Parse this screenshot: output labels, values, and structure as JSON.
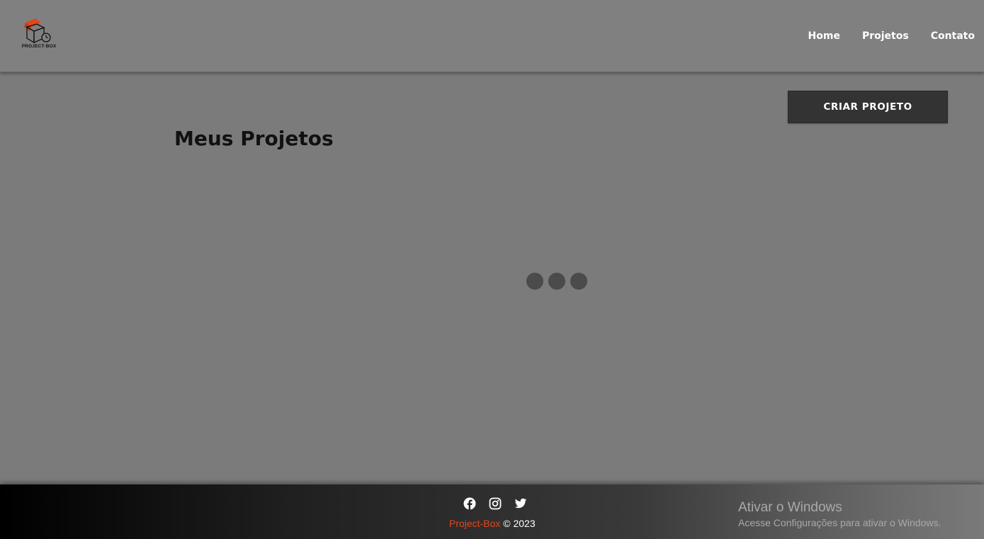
{
  "header": {
    "logo_text": "PROJECT-BOX",
    "nav": [
      "Home",
      "Projetos",
      "Contato"
    ]
  },
  "main": {
    "title": "Meus Projetos",
    "create_button": "CRIAR PROJETO"
  },
  "footer": {
    "brand": "Project-Box",
    "copyright": " © 2023",
    "socials": [
      "facebook-icon",
      "instagram-icon",
      "twitter-icon"
    ]
  },
  "windows_watermark": {
    "title": "Ativar o Windows",
    "subtitle": "Acesse Configurações para ativar o Windows."
  },
  "colors": {
    "overlay": "#7b7b7b",
    "button": "#333333",
    "brand": "#e2461d"
  }
}
